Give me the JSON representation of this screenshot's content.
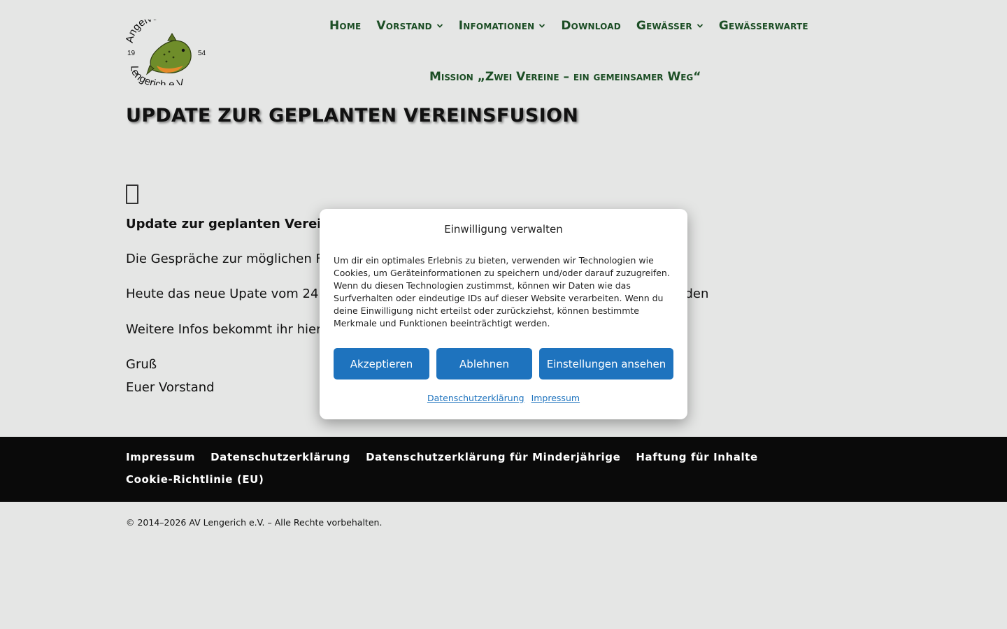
{
  "logo": {
    "arc_top": "Angelverein",
    "arc_bottom": "Lengerich e.V",
    "year_left": "19",
    "year_right": "54"
  },
  "nav": {
    "items": [
      {
        "label": "Home",
        "dropdown": false
      },
      {
        "label": "Vorstand",
        "dropdown": true
      },
      {
        "label": "Infomationen",
        "dropdown": true
      },
      {
        "label": "Download",
        "dropdown": false
      },
      {
        "label": "Gewässer",
        "dropdown": true
      },
      {
        "label": "Gewässerwarte",
        "dropdown": false
      }
    ],
    "second_row": "Mission „Zwei Vereine – ein gemeinsamer Weg“"
  },
  "page": {
    "title": "UPDATE ZUR GEPLANTEN VEREINSFUSION",
    "paragraphs": [
      "Update zur geplanten Verei",
      "Die Gespräche zur möglichen F",
      "Heute das neue Upate vom 24",
      "enden",
      "Weitere Infos bekommt ihr hier",
      "Gruß",
      "Euer Vorstand"
    ]
  },
  "consent": {
    "title": "Einwilligung verwalten",
    "text": "Um dir ein optimales Erlebnis zu bieten, verwenden wir Technologien wie Cookies, um Geräteinformationen zu speichern und/oder darauf zuzugreifen. Wenn du diesen Technologien zustimmst, können wir Daten wie das Surfverhalten oder eindeutige IDs auf dieser Website verarbeiten. Wenn du deine Einwilligung nicht erteilst oder zurückziehst, können bestimmte Merkmale und Funktionen beeinträchtigt werden.",
    "accept": "Akzeptieren",
    "deny": "Ablehnen",
    "settings": "Einstellungen ansehen",
    "link_privacy": "Datenschutzerklärung",
    "link_imprint": "Impressum"
  },
  "footer": {
    "links": [
      "Impressum",
      "Datenschutzerklärung",
      "Datenschutzerklärung für Minderjährige",
      "Haftung für Inhalte",
      "Cookie-Richtlinie (EU)"
    ],
    "copyright": "© 2014–2026 AV Lengerich e.V. – Alle Rechte vorbehalten."
  },
  "colors": {
    "background": "#e5e6e5",
    "nav_green": "#1c4e25",
    "button_blue": "#1e73be",
    "footer_black": "#0a0a0a"
  }
}
